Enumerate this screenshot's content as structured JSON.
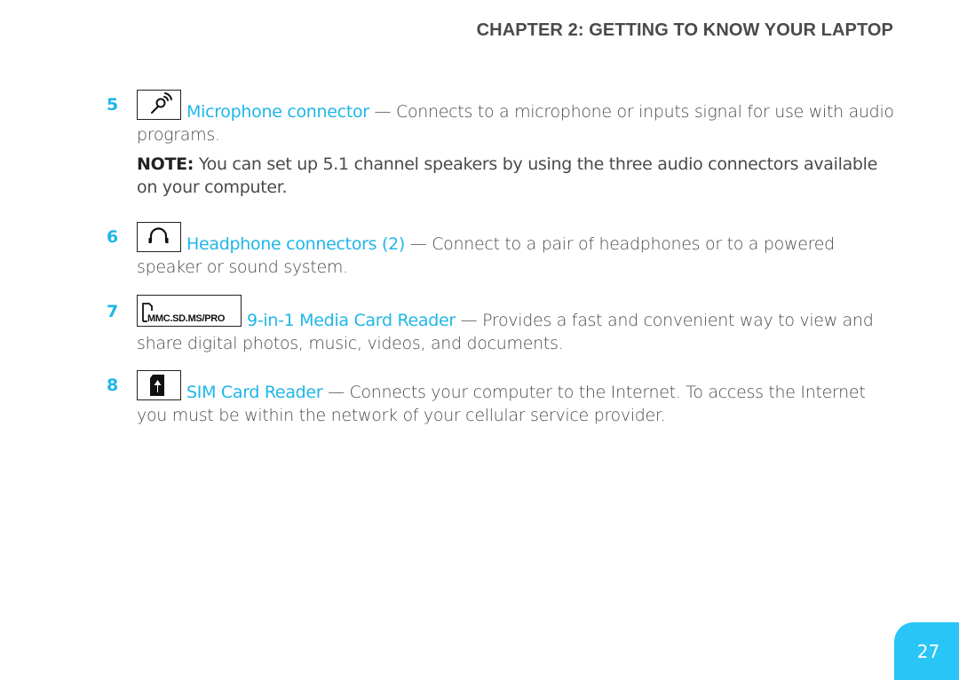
{
  "header": {
    "chapter_title": "CHAPTER 2: GETTING TO KNOW YOUR LAPTOP"
  },
  "accent_color": "#1fb6e8",
  "items": [
    {
      "number": "5",
      "icon": "microphone-icon",
      "term": "Microphone connector",
      "description": " — Connects to a microphone or inputs signal for use with audio programs."
    },
    {
      "number": "6",
      "icon": "headphones-icon",
      "term": "Headphone connectors (2)",
      "description": " — Connect to a pair of headphones or to a powered speaker or sound system."
    },
    {
      "number": "7",
      "icon": "media-card-icon",
      "icon_label": "MMC.SD.MS/PRO",
      "term": "9-in-1 Media Card Reader",
      "description": " — Provides a fast and convenient way to view and share digital photos, music, videos, and documents."
    },
    {
      "number": "8",
      "icon": "sim-card-icon",
      "term": "SIM Card Reader",
      "description": " — Connects your computer to the Internet. To access the Internet you must be within the network of your cellular service provider."
    }
  ],
  "note": {
    "label": "NOTE:",
    "text": " You can set up 5.1 channel speakers by using the three audio connectors available on your computer."
  },
  "footer": {
    "page_number": "27"
  }
}
